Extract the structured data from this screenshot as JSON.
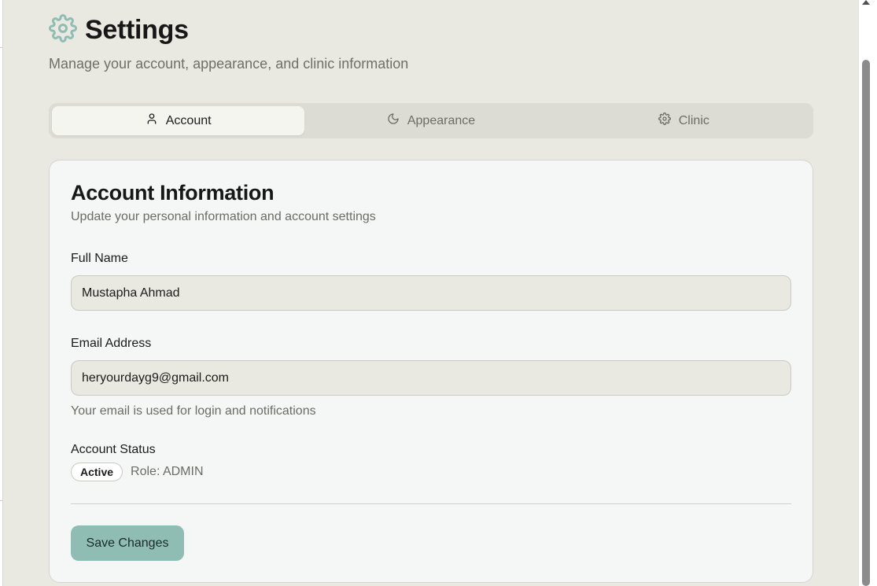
{
  "header": {
    "title": "Settings",
    "subtitle": "Manage your account, appearance, and clinic information",
    "icon": "gear-icon",
    "accent_color": "#8fbdb3"
  },
  "tabs": [
    {
      "label": "Account",
      "icon": "user-icon",
      "active": true
    },
    {
      "label": "Appearance",
      "icon": "moon-icon",
      "active": false
    },
    {
      "label": "Clinic",
      "icon": "gear-icon",
      "active": false
    }
  ],
  "account_card": {
    "title": "Account Information",
    "description": "Update your personal information and account settings",
    "full_name_label": "Full Name",
    "full_name_value": "Mustapha Ahmad",
    "email_label": "Email Address",
    "email_value": "heryourdayg9@gmail.com",
    "email_help": "Your email is used for login and notifications",
    "status_label": "Account Status",
    "status_badge": "Active",
    "role_text": "Role: ADMIN",
    "save_label": "Save Changes"
  }
}
